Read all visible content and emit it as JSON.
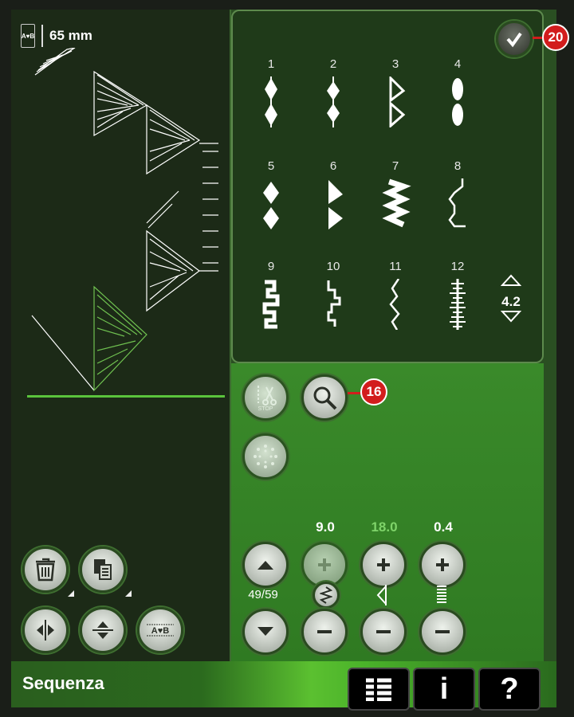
{
  "sequence": {
    "length": "65 mm",
    "length_icon_text": "A♥B"
  },
  "menu": {
    "stitches": [
      {
        "num": "1",
        "icon": "stitch-diamond-double-icon"
      },
      {
        "num": "2",
        "icon": "stitch-diamond-small-icon"
      },
      {
        "num": "3",
        "icon": "stitch-triangle-double-icon"
      },
      {
        "num": "4",
        "icon": "stitch-oval-double-icon"
      },
      {
        "num": "5",
        "icon": "stitch-diamond-pair-icon"
      },
      {
        "num": "6",
        "icon": "stitch-triangle-pair-icon"
      },
      {
        "num": "7",
        "icon": "stitch-zigzag-block-icon"
      },
      {
        "num": "8",
        "icon": "stitch-wave-outline-icon"
      },
      {
        "num": "9",
        "icon": "stitch-step-block-icon"
      },
      {
        "num": "10",
        "icon": "stitch-step-outline-icon"
      },
      {
        "num": "11",
        "icon": "stitch-serpentine-icon"
      },
      {
        "num": "12",
        "icon": "stitch-fringe-icon"
      }
    ],
    "scroll_value": "4.2"
  },
  "settings": {
    "width_value": "9.0",
    "position_value": "18.0",
    "length_value": "0.4",
    "counter": "49/59"
  },
  "callouts": {
    "ok": "20",
    "zoom": "16"
  },
  "bottom": {
    "title": "Sequenza",
    "info_label": "i",
    "help_label": "?"
  },
  "colors": {
    "accent_green": "#5ac43c",
    "callout_red": "#d21d1d"
  }
}
